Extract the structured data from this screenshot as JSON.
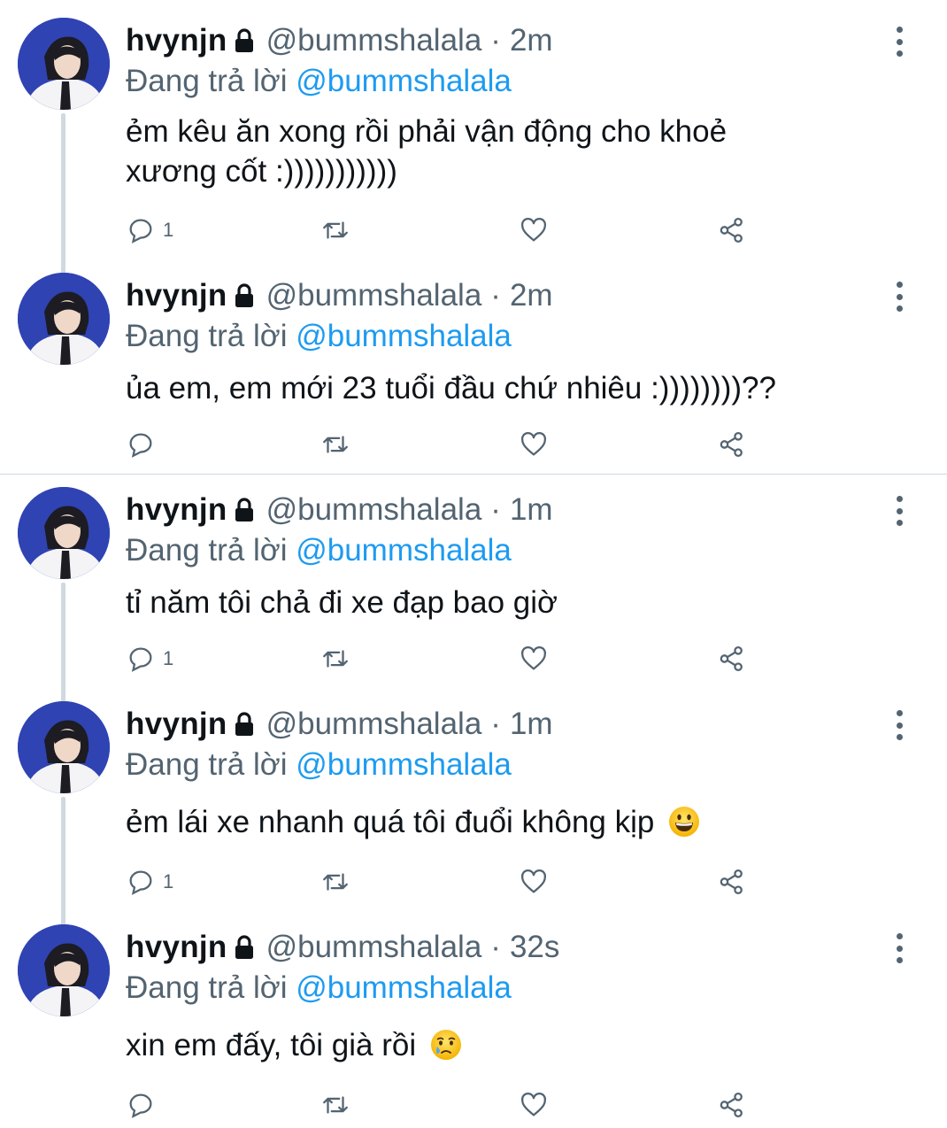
{
  "tweets": [
    {
      "name": "hvynjn",
      "handle": "@bummshalala",
      "dot": "·",
      "time": "2m",
      "replying_prefix": "Đang trả lời",
      "replying_to": "@bummshalala",
      "text": "ẻm kêu ăn xong rồi phải vận động cho khoẻ xương cốt :)))))))))))",
      "reply_count": "1",
      "emoji": ""
    },
    {
      "name": "hvynjn",
      "handle": "@bummshalala",
      "dot": "·",
      "time": "2m",
      "replying_prefix": "Đang trả lời",
      "replying_to": "@bummshalala",
      "text": "ủa em, em mới 23 tuổi đầu chứ nhiêu :))))))))??",
      "reply_count": "",
      "emoji": ""
    },
    {
      "name": "hvynjn",
      "handle": "@bummshalala",
      "dot": "·",
      "time": "1m",
      "replying_prefix": "Đang trả lời",
      "replying_to": "@bummshalala",
      "text": "tỉ năm tôi chả đi xe đạp bao giờ",
      "reply_count": "1",
      "emoji": ""
    },
    {
      "name": "hvynjn",
      "handle": "@bummshalala",
      "dot": "·",
      "time": "1m",
      "replying_prefix": "Đang trả lời",
      "replying_to": "@bummshalala",
      "text": "ẻm lái xe nhanh quá tôi đuổi không kịp",
      "reply_count": "1",
      "emoji": "grinning-face-emoji"
    },
    {
      "name": "hvynjn",
      "handle": "@bummshalala",
      "dot": "·",
      "time": "32s",
      "replying_prefix": "Đang trả lời",
      "replying_to": "@bummshalala",
      "text": "xin em đấy, tôi già rồi",
      "reply_count": "",
      "emoji": "crying-face-emoji"
    }
  ],
  "icons": {
    "lock": "lock-icon",
    "more": "more-vertical-icon",
    "reply": "reply-icon",
    "retweet": "retweet-icon",
    "like": "heart-icon",
    "share": "share-icon"
  },
  "colors": {
    "text": "#0f1419",
    "secondary": "#536471",
    "mention": "#1d9bf0",
    "divider": "#cfd9de",
    "avatar_bg": "#2f43b3"
  }
}
